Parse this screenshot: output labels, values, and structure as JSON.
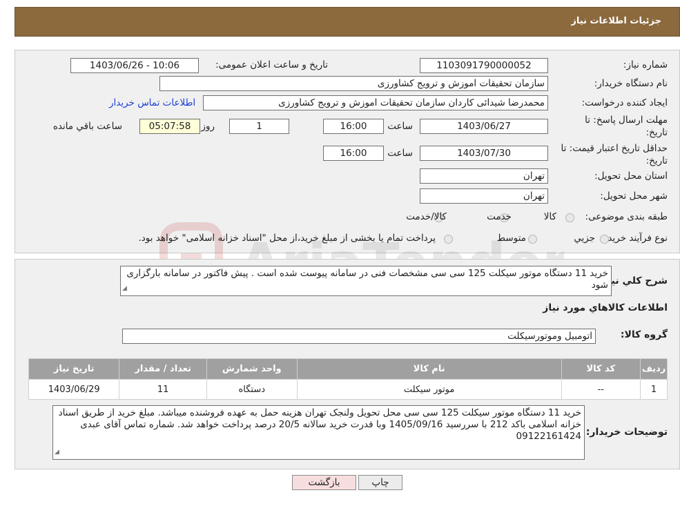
{
  "header": {
    "title": "جزئیات اطلاعات نیاز"
  },
  "form": {
    "need_number_label": "شماره نیاز:",
    "need_number": "1103091790000052",
    "announce_label": "تاریخ و ساعت اعلان عمومی:",
    "announce_value": "1403/06/26 - 10:06",
    "buyer_org_label": "نام دستگاه خریدار:",
    "buyer_org": "سازمان تحقیقات  اموزش و ترویج کشاورزی",
    "requester_label": "ایجاد کننده درخواست:",
    "requester": "محمدرضا شیدائی کاردان سازمان تحقیقات  اموزش و ترویج کشاورزی",
    "contact_link": "اطلاعات تماس خریدار",
    "reply_deadline_label": "مهلت ارسال پاسخ: تا تاریخ:",
    "reply_date": "1403/06/27",
    "time_label": "ساعت",
    "reply_time": "16:00",
    "days_value": "1",
    "days_label": "روز و",
    "remaining_time": "05:07:58",
    "remaining_label": "ساعت باقي مانده",
    "validity_label": "حداقل تاریخ اعتبار قیمت: تا تاریخ:",
    "validity_date": "1403/07/30",
    "validity_time": "16:00",
    "province_label": "استان محل تحویل:",
    "province": "تهران",
    "city_label": "شهر محل تحویل:",
    "city": "تهران",
    "category_label": "طبقه بندی موضوعی:",
    "category_options": [
      "کالا",
      "خدمت",
      "کالا/خدمت"
    ],
    "process_label": "نوع فرآیند خرید :",
    "process_options": [
      "جزيي",
      "متوسط"
    ],
    "process_note": "پرداخت تمام یا بخشی از مبلغ خرید،از محل \"اسناد خزانه اسلامی\" خواهد بود."
  },
  "details": {
    "summary_label": "شرح کلي نياز:",
    "summary_text": "خرید 11 دستگاه موتور سیکلت 125 سی سی  مشخصات فنی در سامانه پیوست شده است . پیش فاکتور در سامانه بارگزاری شود",
    "goods_info_title": "اطلاعات کالاهاي مورد نياز",
    "group_label": "گروه کالا:",
    "group_value": "اتومبیل وموتورسیکلت",
    "table": {
      "headers": [
        "رديف",
        "کد کالا",
        "نام کالا",
        "واحد شمارش",
        "تعداد / مقدار",
        "تاريخ نياز"
      ],
      "rows": [
        [
          "1",
          "--",
          "موتور سیکلت",
          "دستگاه",
          "11",
          "1403/06/29"
        ]
      ]
    },
    "buyer_notes_label": "توضیحات خریدار:",
    "buyer_notes": "خرید 11 دستگاه موتور سیکلت 125 سی سی  محل تحویل ولنجک تهران هزینه حمل به عهده فروشنده میباشد. مبلغ خرید از طریق اسناد خزانه اسلامی باکد 212 با سررسید 1405/09/16 وبا قدرت خرید سالانه 20/5 درصد پرداخت خواهد شد. شماره تماس آقای عبدی 09122161424"
  },
  "buttons": {
    "print": "چاپ",
    "back": "بازگشت"
  },
  "watermark": {
    "text": "AriaTender.neT"
  },
  "colors": {
    "header_bg": "#8c6a3e",
    "table_header_bg": "#a0a0a0",
    "link": "#1a3fd6",
    "back_button_bg": "#f7dede"
  }
}
